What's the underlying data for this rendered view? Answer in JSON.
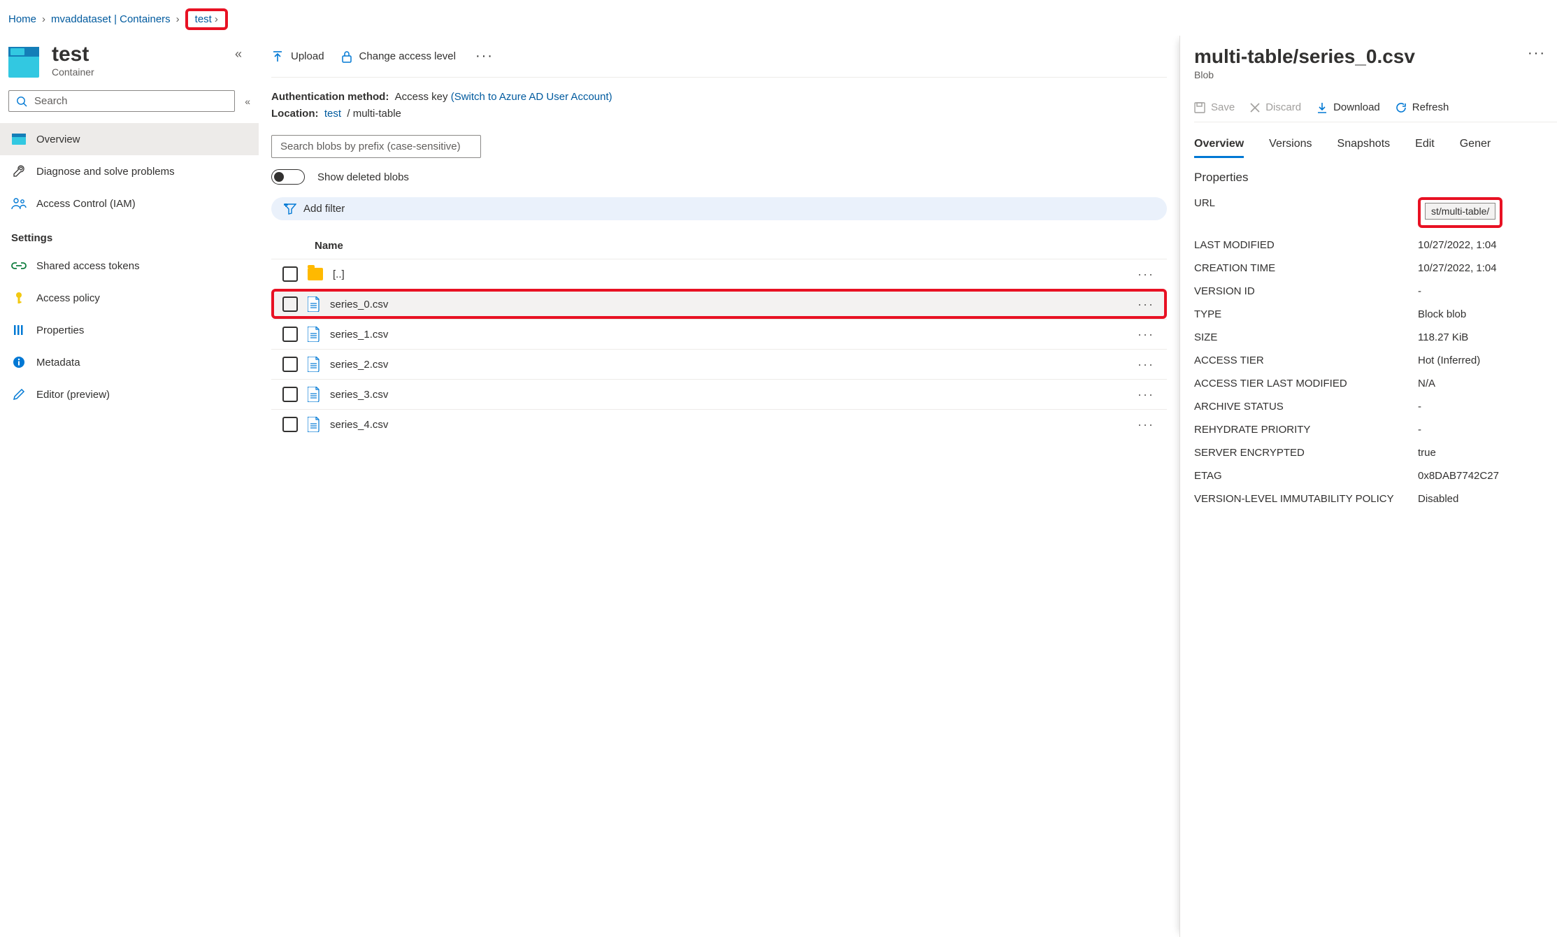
{
  "breadcrumb": {
    "home": "Home",
    "account": "mvaddataset | Containers",
    "container": "test"
  },
  "title": {
    "name": "test",
    "type": "Container"
  },
  "search": {
    "placeholder": "Search"
  },
  "nav": {
    "overview": "Overview",
    "diagnose": "Diagnose and solve problems",
    "iam": "Access Control (IAM)",
    "settings_section": "Settings",
    "sas": "Shared access tokens",
    "access_policy": "Access policy",
    "properties": "Properties",
    "metadata": "Metadata",
    "editor": "Editor (preview)"
  },
  "mid_toolbar": {
    "upload": "Upload",
    "change_access": "Change access level",
    "auth_label": "Authentication method:",
    "auth_value": "Access key",
    "auth_switch": "(Switch to Azure AD User Account)",
    "location_label": "Location:",
    "location_root": "test",
    "location_path": "multi-table",
    "prefix_placeholder": "Search blobs by prefix (case-sensitive)",
    "show_deleted": "Show deleted blobs",
    "add_filter": "Add filter"
  },
  "table": {
    "header_name": "Name",
    "rows": [
      {
        "name": "[..]",
        "type": "folder"
      },
      {
        "name": "series_0.csv",
        "type": "file",
        "selected": true,
        "highlighted": true
      },
      {
        "name": "series_1.csv",
        "type": "file"
      },
      {
        "name": "series_2.csv",
        "type": "file"
      },
      {
        "name": "series_3.csv",
        "type": "file"
      },
      {
        "name": "series_4.csv",
        "type": "file"
      }
    ]
  },
  "right": {
    "title": "multi-table/series_0.csv",
    "type": "Blob",
    "toolbar": {
      "save": "Save",
      "discard": "Discard",
      "download": "Download",
      "refresh": "Refresh"
    },
    "tabs": {
      "overview": "Overview",
      "versions": "Versions",
      "snapshots": "Snapshots",
      "edit": "Edit",
      "generate": "Gener"
    },
    "props_title": "Properties",
    "props": {
      "url_label": "URL",
      "url_value": "st/multi-table/",
      "last_modified_label": "LAST MODIFIED",
      "last_modified_value": "10/27/2022, 1:04",
      "creation_time_label": "CREATION TIME",
      "creation_time_value": "10/27/2022, 1:04",
      "version_id_label": "VERSION ID",
      "version_id_value": "-",
      "type_label": "TYPE",
      "type_value": "Block blob",
      "size_label": "SIZE",
      "size_value": "118.27 KiB",
      "access_tier_label": "ACCESS TIER",
      "access_tier_value": "Hot (Inferred)",
      "access_tier_lm_label": "ACCESS TIER LAST MODIFIED",
      "access_tier_lm_value": "N/A",
      "archive_status_label": "ARCHIVE STATUS",
      "archive_status_value": "-",
      "rehydrate_label": "REHYDRATE PRIORITY",
      "rehydrate_value": "-",
      "encrypted_label": "SERVER ENCRYPTED",
      "encrypted_value": "true",
      "etag_label": "ETAG",
      "etag_value": "0x8DAB7742C27",
      "immutability_label": "VERSION-LEVEL IMMUTABILITY POLICY",
      "immutability_value": "Disabled"
    }
  }
}
